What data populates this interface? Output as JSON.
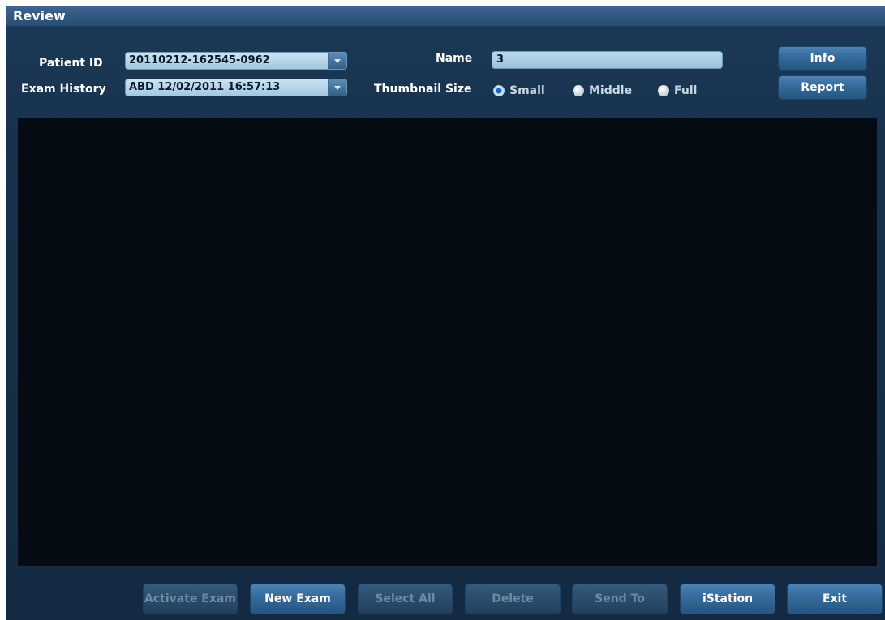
{
  "window": {
    "title": "Review"
  },
  "patient": {
    "id_label": "Patient ID",
    "id_value": "20110212-162545-0962",
    "history_label": "Exam History",
    "history_value": "ABD 12/02/2011 16:57:13",
    "name_label": "Name",
    "name_value": "3"
  },
  "thumbnail": {
    "label": "Thumbnail Size",
    "selected": "Small",
    "options": [
      "Small",
      "Middle",
      "Full"
    ]
  },
  "side_buttons": {
    "info": "Info",
    "report": "Report"
  },
  "bottom_buttons": {
    "activate_exam": "Activate Exam",
    "new_exam": "New Exam",
    "select_all": "Select All",
    "delete": "Delete",
    "send_to": "Send To",
    "istation": "iStation",
    "exit": "Exit"
  },
  "colors": {
    "panel_bg": "#18324d",
    "title_bar": "#2f5880",
    "viewer_bg": "#040b12",
    "button": "#346a9b",
    "button_disabled": "#2b4c6c"
  }
}
